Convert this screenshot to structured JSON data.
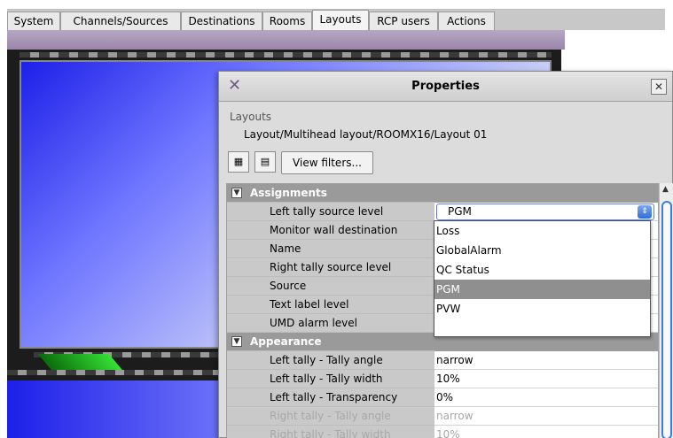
{
  "tabs": [
    {
      "label": "System"
    },
    {
      "label": "Channels/Sources"
    },
    {
      "label": "Destinations"
    },
    {
      "label": "Rooms"
    },
    {
      "label": "Layouts",
      "active": true
    },
    {
      "label": "RCP users"
    },
    {
      "label": "Actions"
    }
  ],
  "dialog": {
    "title": "Properties",
    "close_icon": "close-icon",
    "logo_icon": "x-logo-icon",
    "breadcrumb_root": "Layouts",
    "breadcrumb_path": "Layout/Multihead layout/ROOMX16/Layout 01",
    "toolbar": {
      "categorized_icon": "categorized-view-icon",
      "list_icon": "list-view-icon",
      "view_filters_label": "View filters..."
    }
  },
  "grid": {
    "sections": [
      {
        "name": "Assignments",
        "rows": [
          {
            "label": "Left tally source level",
            "value": "PGM",
            "editor": "combo"
          },
          {
            "label": "Monitor wall destination",
            "value": ""
          },
          {
            "label": "Name",
            "value": ""
          },
          {
            "label": "Right tally source level",
            "value": ""
          },
          {
            "label": "Source",
            "value": ""
          },
          {
            "label": "Text label level",
            "value": ""
          },
          {
            "label": "UMD alarm level",
            "value": ""
          }
        ]
      },
      {
        "name": "Appearance",
        "rows": [
          {
            "label": "Left tally - Tally angle",
            "value": "narrow"
          },
          {
            "label": "Left tally - Tally width",
            "value": "10%"
          },
          {
            "label": "Left tally - Transparency",
            "value": "0%"
          },
          {
            "label": "Right tally - Tally angle",
            "value": "narrow",
            "disabled": true
          },
          {
            "label": "Right tally - Tally width",
            "value": "10%",
            "disabled": true
          }
        ]
      }
    ]
  },
  "dropdown": {
    "options": [
      "Loss",
      "GlobalAlarm",
      "QC Status",
      "PGM",
      "PVW"
    ],
    "selected": "PGM"
  }
}
